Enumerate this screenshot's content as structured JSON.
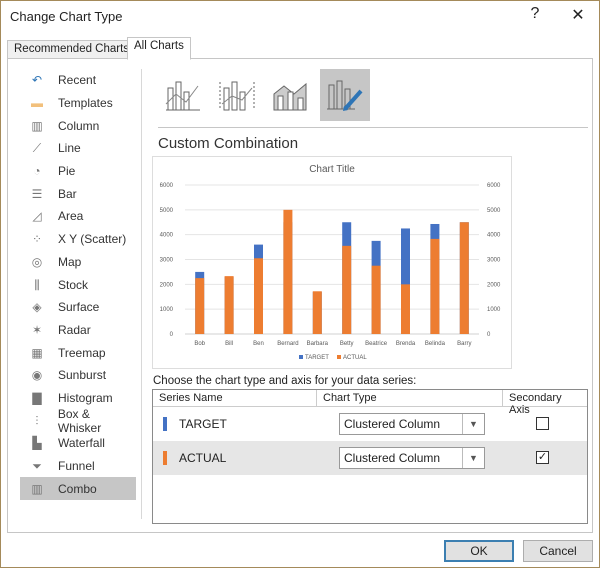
{
  "dialog": {
    "title": "Change Chart Type",
    "help": "?",
    "close": "✕"
  },
  "tabs": [
    {
      "label": "Recommended Charts"
    },
    {
      "label": "All Charts"
    }
  ],
  "sidebar": {
    "items": [
      {
        "label": "Recent",
        "icon": "↶"
      },
      {
        "label": "Templates",
        "icon": "▬"
      },
      {
        "label": "Column",
        "icon": "▥"
      },
      {
        "label": "Line",
        "icon": "⟋"
      },
      {
        "label": "Pie",
        "icon": "◔"
      },
      {
        "label": "Bar",
        "icon": "☰"
      },
      {
        "label": "Area",
        "icon": "◿"
      },
      {
        "label": "X Y (Scatter)",
        "icon": "⁘"
      },
      {
        "label": "Map",
        "icon": "◎"
      },
      {
        "label": "Stock",
        "icon": "⫼"
      },
      {
        "label": "Surface",
        "icon": "◈"
      },
      {
        "label": "Radar",
        "icon": "✶"
      },
      {
        "label": "Treemap",
        "icon": "▦"
      },
      {
        "label": "Sunburst",
        "icon": "◉"
      },
      {
        "label": "Histogram",
        "icon": "▇"
      },
      {
        "label": "Box & Whisker",
        "icon": "⫶"
      },
      {
        "label": "Waterfall",
        "icon": "▙"
      },
      {
        "label": "Funnel",
        "icon": "⏷"
      },
      {
        "label": "Combo",
        "icon": "▥"
      }
    ],
    "selected": "Combo"
  },
  "main": {
    "heading": "Custom Combination",
    "prompt": "Choose the chart type and axis for your data series:",
    "table": {
      "headers": [
        "Series Name",
        "Chart Type",
        "Secondary Axis"
      ],
      "rows": [
        {
          "name": "TARGET",
          "color": "#4472c4",
          "type": "Clustered Column",
          "secondary": false
        },
        {
          "name": "ACTUAL",
          "color": "#ed7d31",
          "type": "Clustered Column",
          "secondary": true
        }
      ]
    }
  },
  "buttons": {
    "ok": "OK",
    "cancel": "Cancel"
  },
  "chart_data": {
    "type": "bar",
    "title": "Chart Title",
    "categories": [
      "Bob",
      "Bill",
      "Ben",
      "Bernard",
      "Barbara",
      "Betty",
      "Beatrice",
      "Brenda",
      "Belinda",
      "Barry"
    ],
    "series": [
      {
        "name": "TARGET",
        "color": "#4472c4",
        "axis": "primary",
        "values": [
          2500,
          2300,
          3600,
          4500,
          1700,
          4500,
          3750,
          4250,
          4430,
          4500
        ]
      },
      {
        "name": "ACTUAL",
        "color": "#ed7d31",
        "axis": "secondary",
        "values": [
          2250,
          2330,
          3050,
          5000,
          1720,
          3550,
          2750,
          2000,
          3830,
          4500
        ]
      }
    ],
    "ylim": [
      0,
      6000
    ],
    "y2lim": [
      0,
      6000
    ],
    "yticks": [
      "0",
      "1000",
      "2000",
      "3000",
      "4000",
      "5000",
      "6000"
    ],
    "legend": "bottom",
    "grid": true
  }
}
